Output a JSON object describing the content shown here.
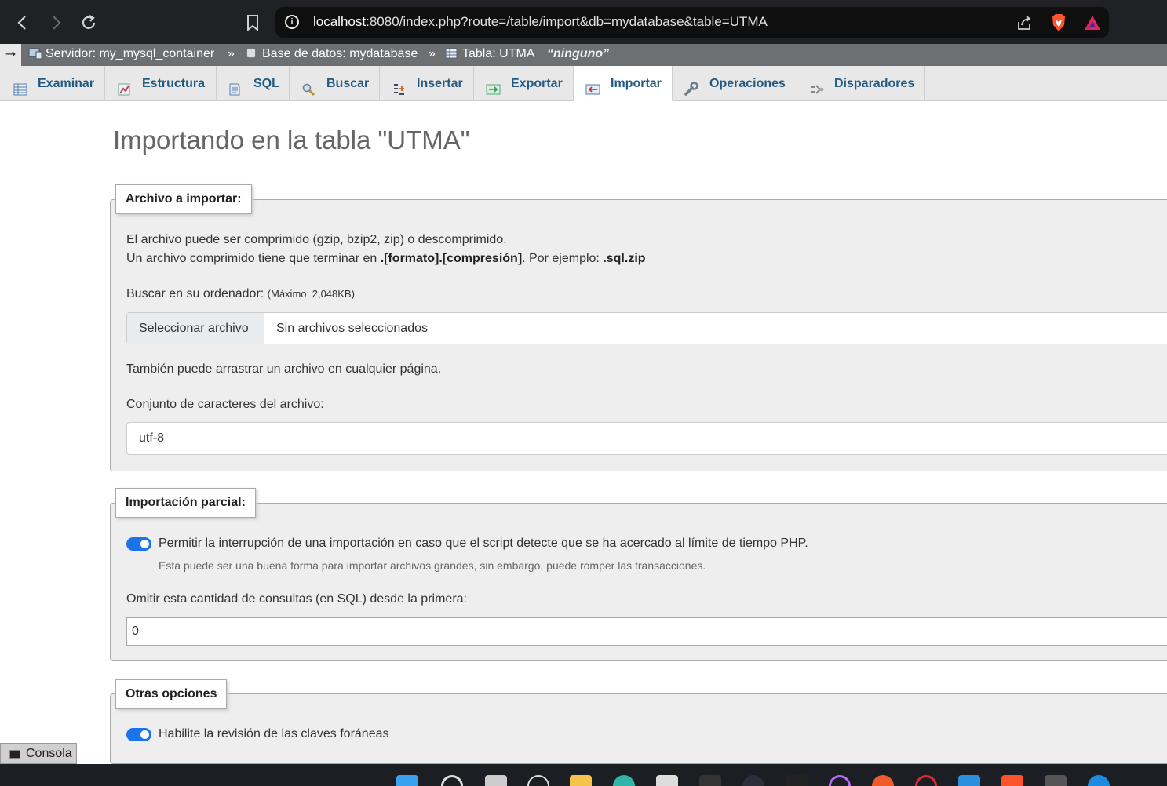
{
  "browser": {
    "url": "localhost:8080/index.php?route=/table/import&db=mydatabase&table=UTMA",
    "url_host": "localhost",
    "url_rest": ":8080/index.php?route=/table/import&db=mydatabase&table=UTMA"
  },
  "breadcrumb": {
    "arrow": "→",
    "server": "Servidor: my_mysql_container",
    "sep1": "»",
    "database": "Base de datos: mydatabase",
    "sep2": "»",
    "table": "Tabla: UTMA",
    "comment": "“ninguno”"
  },
  "tabs": [
    {
      "label": "Examinar",
      "icon": "browse-icon"
    },
    {
      "label": "Estructura",
      "icon": "structure-icon"
    },
    {
      "label": "SQL",
      "icon": "sql-icon"
    },
    {
      "label": "Buscar",
      "icon": "search-icon"
    },
    {
      "label": "Insertar",
      "icon": "insert-icon"
    },
    {
      "label": "Exportar",
      "icon": "export-icon"
    },
    {
      "label": "Importar",
      "icon": "import-icon",
      "active": true
    },
    {
      "label": "Operaciones",
      "icon": "wrench-icon"
    },
    {
      "label": "Disparadores",
      "icon": "triggers-icon"
    }
  ],
  "page": {
    "title": "Importando en la tabla \"UTMA\""
  },
  "file_section": {
    "legend": "Archivo a importar:",
    "line1": "El archivo puede ser comprimido (gzip, bzip2, zip) o descomprimido.",
    "line2_prefix": "Un archivo comprimido tiene que terminar en ",
    "line2_bold": ".[formato].[compresión]",
    "line2_mid": ". Por ejemplo: ",
    "line2_example": ".sql.zip",
    "browse_label": "Buscar en su ordenador:",
    "max_size": "(Máximo: 2,048KB)",
    "file_button": "Seleccionar archivo",
    "file_status": "Sin archivos seleccionados",
    "drag_hint": "También puede arrastrar un archivo en cualquier página.",
    "charset_label": "Conjunto de caracteres del archivo:",
    "charset_value": "utf-8"
  },
  "partial_section": {
    "legend": "Importación parcial:",
    "allow_interrupt_label": "Permitir la interrupción de una importación en caso que el script detecte que se ha acercado al límite de tiempo PHP.",
    "allow_interrupt_checked": true,
    "allow_interrupt_hint": "Esta puede ser una buena forma para importar archivos grandes, sin embargo, puede romper las transacciones.",
    "skip_label": "Omitir esta cantidad de consultas (en SQL) desde la primera:",
    "skip_value": "0"
  },
  "other_section": {
    "legend": "Otras opciones",
    "fk_label": "Habilite la revisión de las claves foráneas",
    "fk_checked": true
  },
  "console": {
    "label": "Consola"
  },
  "colors": {
    "tab_text": "#235a81",
    "breadcrumb_bg": "#6d6f70",
    "toggle_on": "#1a73e8"
  }
}
